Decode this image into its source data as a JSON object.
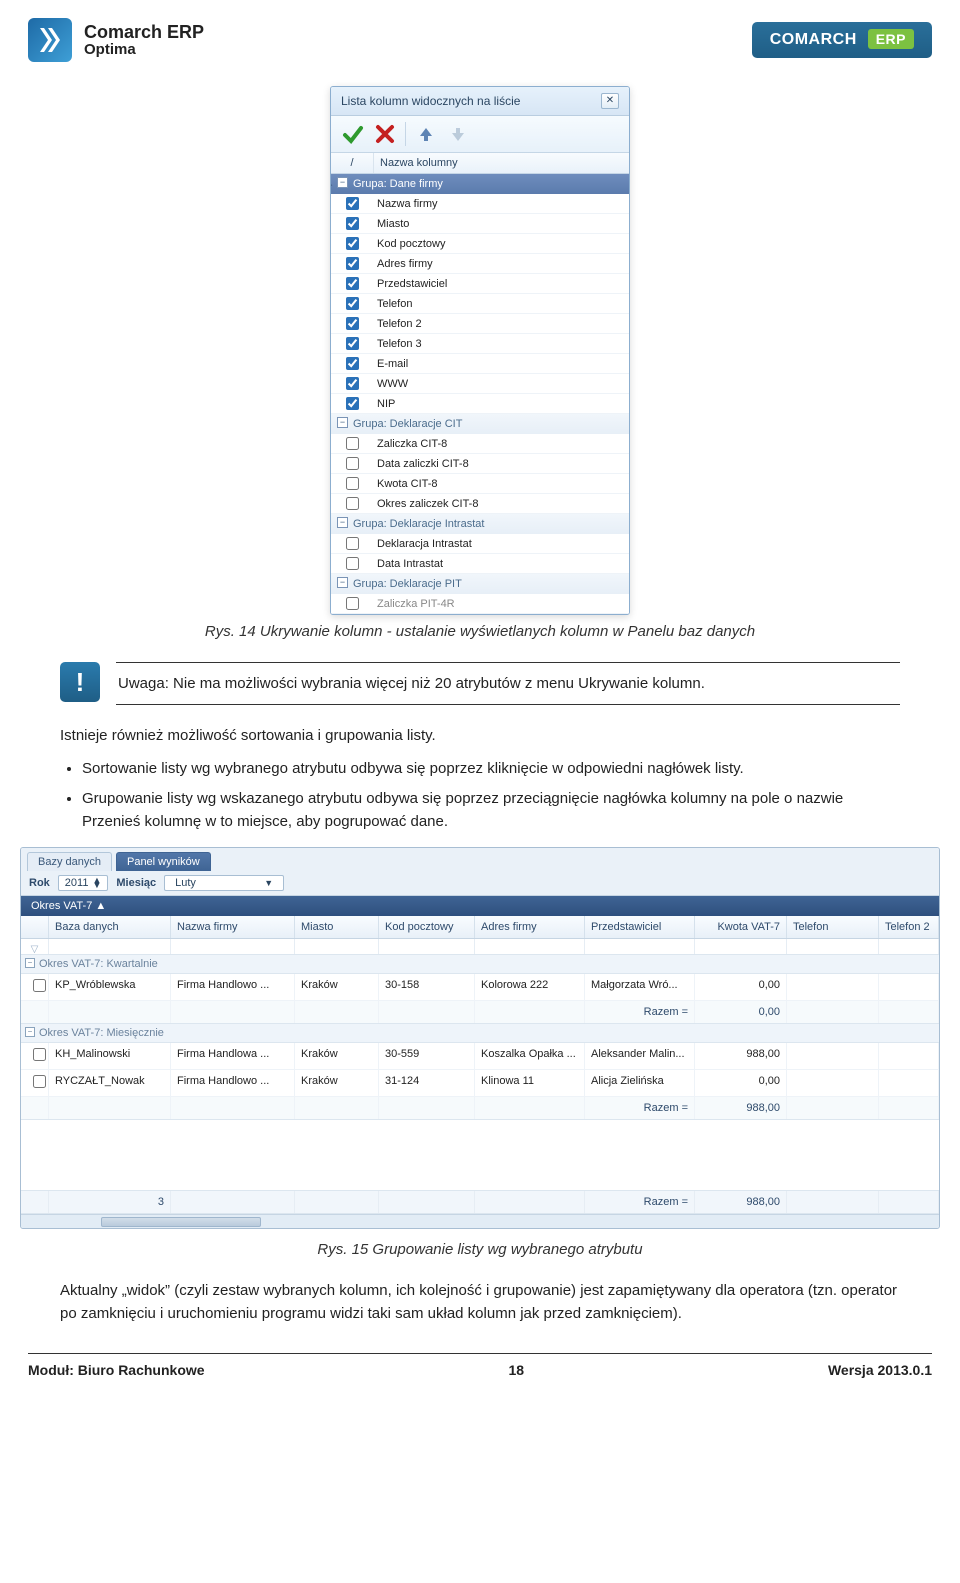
{
  "header": {
    "brand_line1": "Comarch ERP",
    "brand_line2": "Optima",
    "badge_text": "COMARCH",
    "badge_suffix": "ERP"
  },
  "dialog": {
    "title": "Lista kolumn widocznych na liście",
    "close_glyph": "✕",
    "list_header_slash": "/",
    "list_header_name": "Nazwa kolumny",
    "groups": [
      {
        "label": "Grupa: Dane firmy",
        "primary": true,
        "collapsed_glyph": "−",
        "items": [
          {
            "label": "Nazwa firmy",
            "checked": true
          },
          {
            "label": "Miasto",
            "checked": true
          },
          {
            "label": "Kod pocztowy",
            "checked": true
          },
          {
            "label": "Adres firmy",
            "checked": true
          },
          {
            "label": "Przedstawiciel",
            "checked": true
          },
          {
            "label": "Telefon",
            "checked": true
          },
          {
            "label": "Telefon 2",
            "checked": true
          },
          {
            "label": "Telefon 3",
            "checked": true
          },
          {
            "label": "E-mail",
            "checked": true
          },
          {
            "label": "WWW",
            "checked": true
          },
          {
            "label": "NIP",
            "checked": true
          }
        ]
      },
      {
        "label": "Grupa: Deklaracje CIT",
        "primary": false,
        "collapsed_glyph": "−",
        "items": [
          {
            "label": "Zaliczka CIT-8",
            "checked": false
          },
          {
            "label": "Data zaliczki CIT-8",
            "checked": false
          },
          {
            "label": "Kwota CIT-8",
            "checked": false
          },
          {
            "label": "Okres zaliczek CIT-8",
            "checked": false
          }
        ]
      },
      {
        "label": "Grupa: Deklaracje Intrastat",
        "primary": false,
        "collapsed_glyph": "−",
        "items": [
          {
            "label": "Deklaracja Intrastat",
            "checked": false
          },
          {
            "label": "Data Intrastat",
            "checked": false
          }
        ]
      },
      {
        "label": "Grupa: Deklaracje PIT",
        "primary": false,
        "collapsed_glyph": "−",
        "items": [
          {
            "label": "Zaliczka PIT-4R",
            "checked": false
          }
        ]
      }
    ]
  },
  "caption1": "Rys. 14 Ukrywanie kolumn - ustalanie wyświetlanych kolumn w Panelu baz danych",
  "info": {
    "glyph": "!",
    "text": "Uwaga: Nie ma możliwości wybrania więcej niż 20 atrybutów z menu Ukrywanie kolumn."
  },
  "body": {
    "p1": "Istnieje również możliwość sortowania i grupowania listy.",
    "li1": "Sortowanie listy wg wybranego atrybutu odbywa się poprzez kliknięcie w odpowiedni nagłówek listy.",
    "li2": "Grupowanie listy wg wskazanego atrybutu odbywa się poprzez przeciągnięcie nagłówka kolumny na pole o nazwie Przenieś kolumnę w to miejsce, aby pogrupować dane."
  },
  "panel": {
    "tab1": "Bazy danych",
    "tab2": "Panel wyników",
    "lbl_rok": "Rok",
    "val_rok": "2011",
    "lbl_miesiac": "Miesiąc",
    "val_miesiac": "Luty",
    "groupbar": "Okres VAT-7 ▲",
    "headers": {
      "baza": "Baza danych",
      "nazwa": "Nazwa firmy",
      "miasto": "Miasto",
      "kod": "Kod pocztowy",
      "adres": "Adres firmy",
      "przed": "Przedstawiciel",
      "kwota": "Kwota VAT-7",
      "tel": "Telefon",
      "tel2": "Telefon 2"
    },
    "subgroups": [
      {
        "label": "Okres VAT-7: Kwartalnie",
        "rows": [
          {
            "db": "KP_Wróblewska",
            "nf": "Firma Handlowo ...",
            "ms": "Kraków",
            "kp": "30-158",
            "af": "Kolorowa 222",
            "pr": "Małgorzata Wró...",
            "kv": "0,00"
          }
        ],
        "sum_label": "Razem =",
        "sum_value": "0,00"
      },
      {
        "label": "Okres VAT-7: Miesięcznie",
        "rows": [
          {
            "db": "KH_Malinowski",
            "nf": "Firma Handlowa ...",
            "ms": "Kraków",
            "kp": "30-559",
            "af": "Koszalka Opałka ...",
            "pr": "Aleksander Malin...",
            "kv": "988,00"
          },
          {
            "db": "RYCZAŁT_Nowak",
            "nf": "Firma Handlowo ...",
            "ms": "Kraków",
            "kp": "31-124",
            "af": "Klinowa 11",
            "pr": "Alicja Zielińska",
            "kv": "0,00"
          }
        ],
        "sum_label": "Razem =",
        "sum_value": "988,00"
      }
    ],
    "footer_count": "3",
    "footer_sum_label": "Razem =",
    "footer_sum_value": "988,00"
  },
  "caption2": "Rys. 15 Grupowanie listy wg wybranego atrybutu",
  "closing": "Aktualny „widok” (czyli zestaw wybranych kolumn, ich kolejność i grupowanie) jest zapamiętywany dla operatora (tzn. operator po zamknięciu i uruchomieniu programu widzi taki sam układ kolumn jak przed zamknięciem).",
  "footer": {
    "left": "Moduł: Biuro Rachunkowe",
    "center": "18",
    "right": "Wersja 2013.0.1"
  }
}
